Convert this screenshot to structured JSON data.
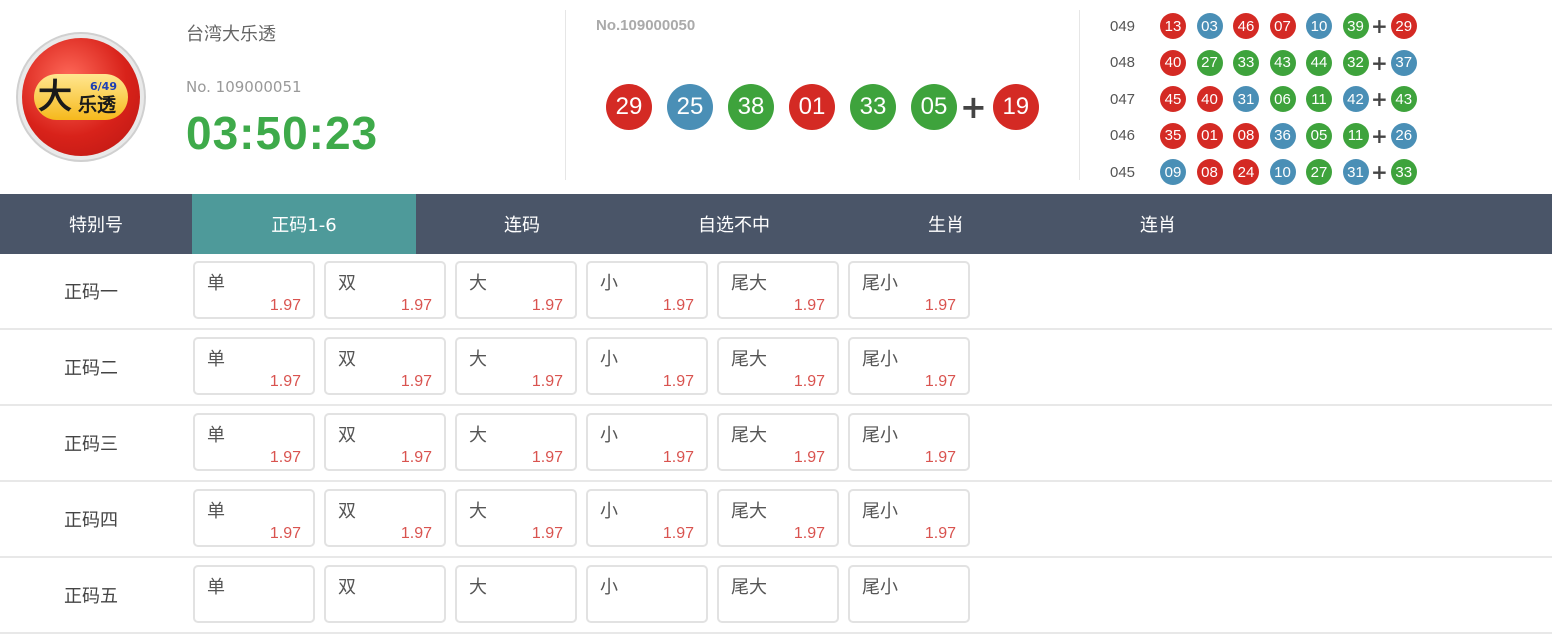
{
  "header": {
    "logo_big": "大",
    "logo_small": "乐透",
    "logo_sub": "6/49",
    "lottery_name": "台湾大乐透",
    "current_no": "No. 109000051",
    "countdown": "03:50:23"
  },
  "last_draw": {
    "no": "No.109000050",
    "balls": [
      {
        "n": "29",
        "color": "red"
      },
      {
        "n": "25",
        "color": "blue"
      },
      {
        "n": "38",
        "color": "green"
      },
      {
        "n": "01",
        "color": "red"
      },
      {
        "n": "33",
        "color": "green"
      },
      {
        "n": "05",
        "color": "green"
      }
    ],
    "special": {
      "n": "19",
      "color": "red"
    },
    "plus": "+"
  },
  "history": [
    {
      "no": "049",
      "balls": [
        [
          "13",
          "red"
        ],
        [
          "03",
          "blue"
        ],
        [
          "46",
          "red"
        ],
        [
          "07",
          "red"
        ],
        [
          "10",
          "blue"
        ],
        [
          "39",
          "green"
        ]
      ],
      "special": [
        "29",
        "red"
      ]
    },
    {
      "no": "048",
      "balls": [
        [
          "40",
          "red"
        ],
        [
          "27",
          "green"
        ],
        [
          "33",
          "green"
        ],
        [
          "43",
          "green"
        ],
        [
          "44",
          "green"
        ],
        [
          "32",
          "green"
        ]
      ],
      "special": [
        "37",
        "blue"
      ]
    },
    {
      "no": "047",
      "balls": [
        [
          "45",
          "red"
        ],
        [
          "40",
          "red"
        ],
        [
          "31",
          "blue"
        ],
        [
          "06",
          "green"
        ],
        [
          "11",
          "green"
        ],
        [
          "42",
          "blue"
        ]
      ],
      "special": [
        "43",
        "green"
      ]
    },
    {
      "no": "046",
      "balls": [
        [
          "35",
          "red"
        ],
        [
          "01",
          "red"
        ],
        [
          "08",
          "red"
        ],
        [
          "36",
          "blue"
        ],
        [
          "05",
          "green"
        ],
        [
          "11",
          "green"
        ]
      ],
      "special": [
        "26",
        "blue"
      ]
    },
    {
      "no": "045",
      "balls": [
        [
          "09",
          "blue"
        ],
        [
          "08",
          "red"
        ],
        [
          "24",
          "red"
        ],
        [
          "10",
          "blue"
        ],
        [
          "27",
          "green"
        ],
        [
          "31",
          "blue"
        ]
      ],
      "special": [
        "33",
        "green"
      ]
    }
  ],
  "tabs": [
    {
      "label": "特别号",
      "active": false
    },
    {
      "label": "正码1-6",
      "active": true
    },
    {
      "label": "连码",
      "active": false
    },
    {
      "label": "自选不中",
      "active": false
    },
    {
      "label": "生肖",
      "active": false
    },
    {
      "label": "连肖",
      "active": false
    }
  ],
  "rows": [
    {
      "label": "正码一",
      "cells": [
        [
          "单",
          "1.97"
        ],
        [
          "双",
          "1.97"
        ],
        [
          "大",
          "1.97"
        ],
        [
          "小",
          "1.97"
        ],
        [
          "尾大",
          "1.97"
        ],
        [
          "尾小",
          "1.97"
        ]
      ]
    },
    {
      "label": "正码二",
      "cells": [
        [
          "单",
          "1.97"
        ],
        [
          "双",
          "1.97"
        ],
        [
          "大",
          "1.97"
        ],
        [
          "小",
          "1.97"
        ],
        [
          "尾大",
          "1.97"
        ],
        [
          "尾小",
          "1.97"
        ]
      ]
    },
    {
      "label": "正码三",
      "cells": [
        [
          "单",
          "1.97"
        ],
        [
          "双",
          "1.97"
        ],
        [
          "大",
          "1.97"
        ],
        [
          "小",
          "1.97"
        ],
        [
          "尾大",
          "1.97"
        ],
        [
          "尾小",
          "1.97"
        ]
      ]
    },
    {
      "label": "正码四",
      "cells": [
        [
          "单",
          "1.97"
        ],
        [
          "双",
          "1.97"
        ],
        [
          "大",
          "1.97"
        ],
        [
          "小",
          "1.97"
        ],
        [
          "尾大",
          "1.97"
        ],
        [
          "尾小",
          "1.97"
        ]
      ]
    },
    {
      "label": "正码五",
      "cells": [
        [
          "单",
          ""
        ],
        [
          "双",
          ""
        ],
        [
          "大",
          ""
        ],
        [
          "小",
          ""
        ],
        [
          "尾大",
          ""
        ],
        [
          "尾小",
          ""
        ]
      ]
    }
  ]
}
